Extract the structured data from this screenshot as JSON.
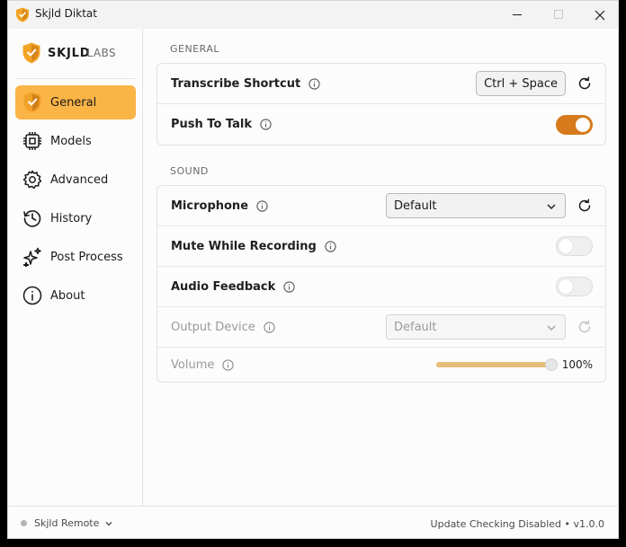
{
  "window": {
    "title": "Skjld Diktat"
  },
  "logo": {
    "brand_bold": "SKJLD",
    "brand_light": "LABS"
  },
  "sidebar": {
    "items": [
      {
        "label": "General",
        "icon": "shield-icon",
        "active": true
      },
      {
        "label": "Models",
        "icon": "cpu-icon",
        "active": false
      },
      {
        "label": "Advanced",
        "icon": "gear-icon",
        "active": false
      },
      {
        "label": "History",
        "icon": "history-icon",
        "active": false
      },
      {
        "label": "Post Process",
        "icon": "sparkles-icon",
        "active": false
      },
      {
        "label": "About",
        "icon": "info-circle-icon",
        "active": false
      }
    ]
  },
  "footer": {
    "remote_label": "Skjld Remote",
    "update_text": "Update Checking Disabled • v1.0.0"
  },
  "general": {
    "title": "GENERAL",
    "transcribe_shortcut": {
      "label": "Transcribe Shortcut",
      "value": "Ctrl + Space"
    },
    "push_to_talk": {
      "label": "Push To Talk",
      "enabled": true
    }
  },
  "sound": {
    "title": "SOUND",
    "microphone": {
      "label": "Microphone",
      "value": "Default"
    },
    "mute_while_recording": {
      "label": "Mute While Recording",
      "enabled": false
    },
    "audio_feedback": {
      "label": "Audio Feedback",
      "enabled": false
    },
    "output_device": {
      "label": "Output Device",
      "value": "Default",
      "disabled": true
    },
    "volume": {
      "label": "Volume",
      "value_text": "100%",
      "level": 1.0,
      "disabled": true
    }
  },
  "colors": {
    "accent": "#fbb446",
    "toggle_on": "#d67a1c",
    "slider": "#e6bd79"
  }
}
